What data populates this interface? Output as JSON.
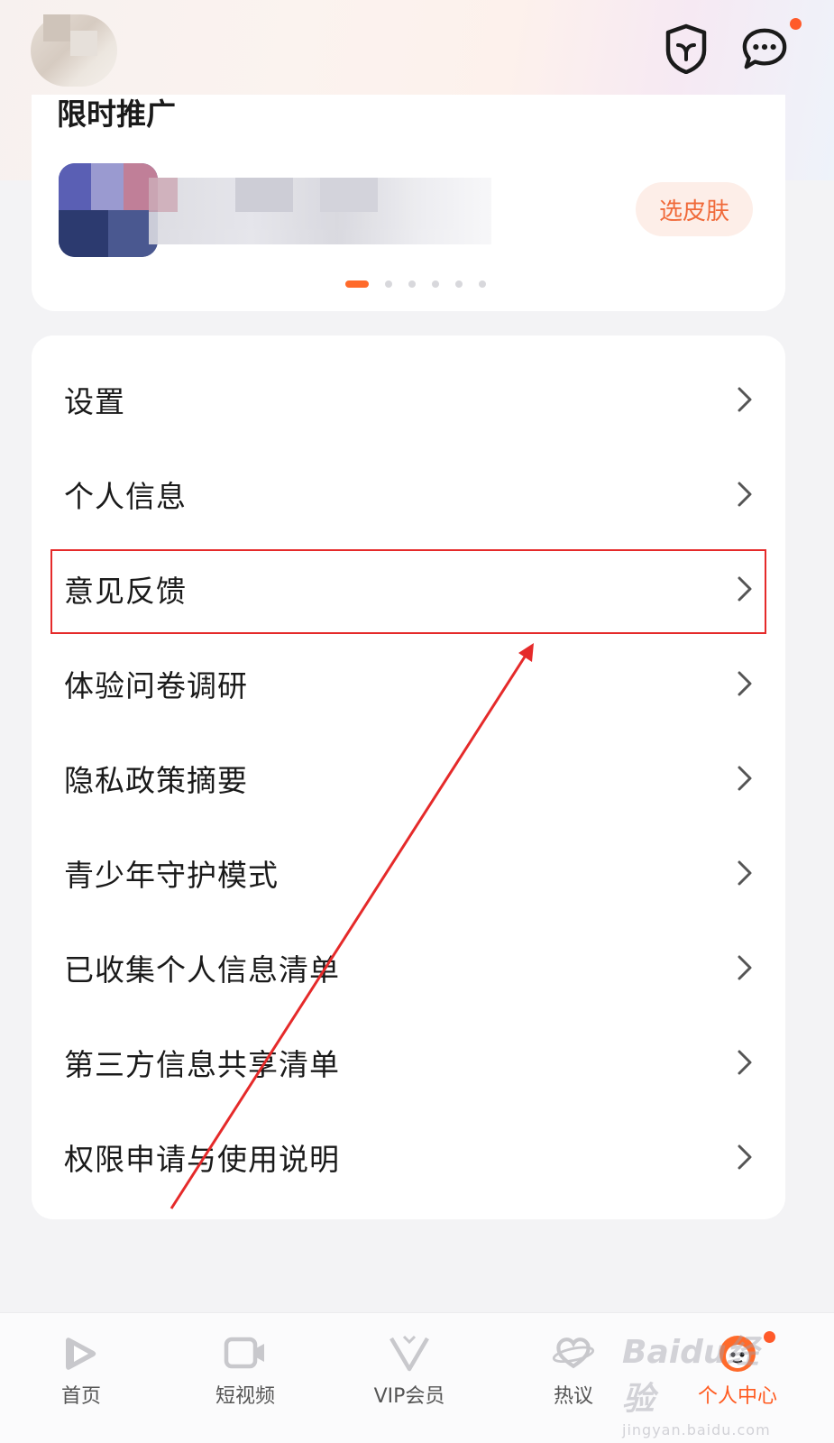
{
  "promo": {
    "title": "限时推广",
    "skin_button": "选皮肤",
    "pager": {
      "count": 6,
      "active_index": 0
    }
  },
  "menu": {
    "items": [
      {
        "label": "设置"
      },
      {
        "label": "个人信息"
      },
      {
        "label": "意见反馈"
      },
      {
        "label": "体验问卷调研"
      },
      {
        "label": "隐私政策摘要"
      },
      {
        "label": "青少年守护模式"
      },
      {
        "label": "已收集个人信息清单"
      },
      {
        "label": "第三方信息共享清单"
      },
      {
        "label": "权限申请与使用说明"
      }
    ]
  },
  "tabbar": {
    "tabs": [
      {
        "label": "首页",
        "icon": "home-play-icon"
      },
      {
        "label": "短视频",
        "icon": "video-camera-icon"
      },
      {
        "label": "VIP会员",
        "icon": "vip-v-icon"
      },
      {
        "label": "热议",
        "icon": "planet-heart-icon"
      },
      {
        "label": "个人中心",
        "icon": "profile-mascot-icon"
      }
    ],
    "active_index": 4
  },
  "watermark": {
    "brand": "Baidu经验",
    "url": "jingyan.baidu.com"
  },
  "colors": {
    "accent": "#ff5a1f",
    "annotation": "#e52a2a"
  }
}
